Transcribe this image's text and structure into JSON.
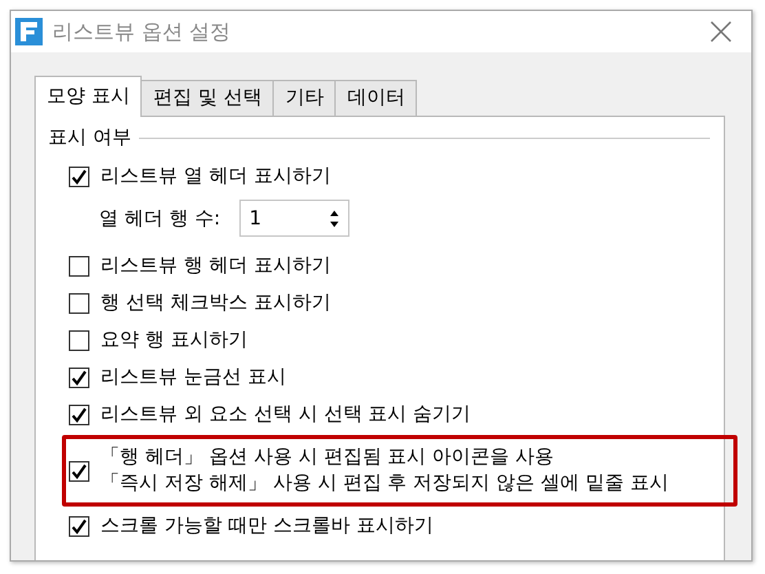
{
  "window": {
    "title": "리스트뷰 옵션 설정"
  },
  "tabs": [
    {
      "label": "모양 표시",
      "selected": true
    },
    {
      "label": "편집 및 선택",
      "selected": false
    },
    {
      "label": "기타",
      "selected": false
    },
    {
      "label": "데이터",
      "selected": false
    }
  ],
  "group": {
    "title": "표시 여부"
  },
  "options": [
    {
      "kind": "checkbox",
      "lines": [
        "리스트뷰 열 헤더 표시하기"
      ],
      "checked": true,
      "highlighted": false
    },
    {
      "kind": "spinner",
      "label": "열 헤더 행 수:",
      "value": "1"
    },
    {
      "kind": "checkbox",
      "lines": [
        "리스트뷰 행 헤더 표시하기"
      ],
      "checked": false,
      "highlighted": false
    },
    {
      "kind": "checkbox",
      "lines": [
        "행 선택 체크박스 표시하기"
      ],
      "checked": false,
      "highlighted": false
    },
    {
      "kind": "checkbox",
      "lines": [
        "요약 행 표시하기"
      ],
      "checked": false,
      "highlighted": false
    },
    {
      "kind": "checkbox",
      "lines": [
        "리스트뷰 눈금선 표시"
      ],
      "checked": true,
      "highlighted": false
    },
    {
      "kind": "checkbox",
      "lines": [
        "리스트뷰 외 요소 선택 시 선택 표시 숨기기"
      ],
      "checked": true,
      "highlighted": false
    },
    {
      "kind": "checkbox",
      "lines": [
        "「행 헤더」 옵션 사용 시 편집됨 표시 아이콘을 사용",
        "「즉시 저장 해제」 사용 시 편집 후 저장되지 않은 셀에 밑줄 표시"
      ],
      "checked": true,
      "highlighted": true
    },
    {
      "kind": "checkbox",
      "lines": [
        "스크롤 가능할 때만 스크롤바 표시하기"
      ],
      "checked": true,
      "highlighted": false
    }
  ]
}
